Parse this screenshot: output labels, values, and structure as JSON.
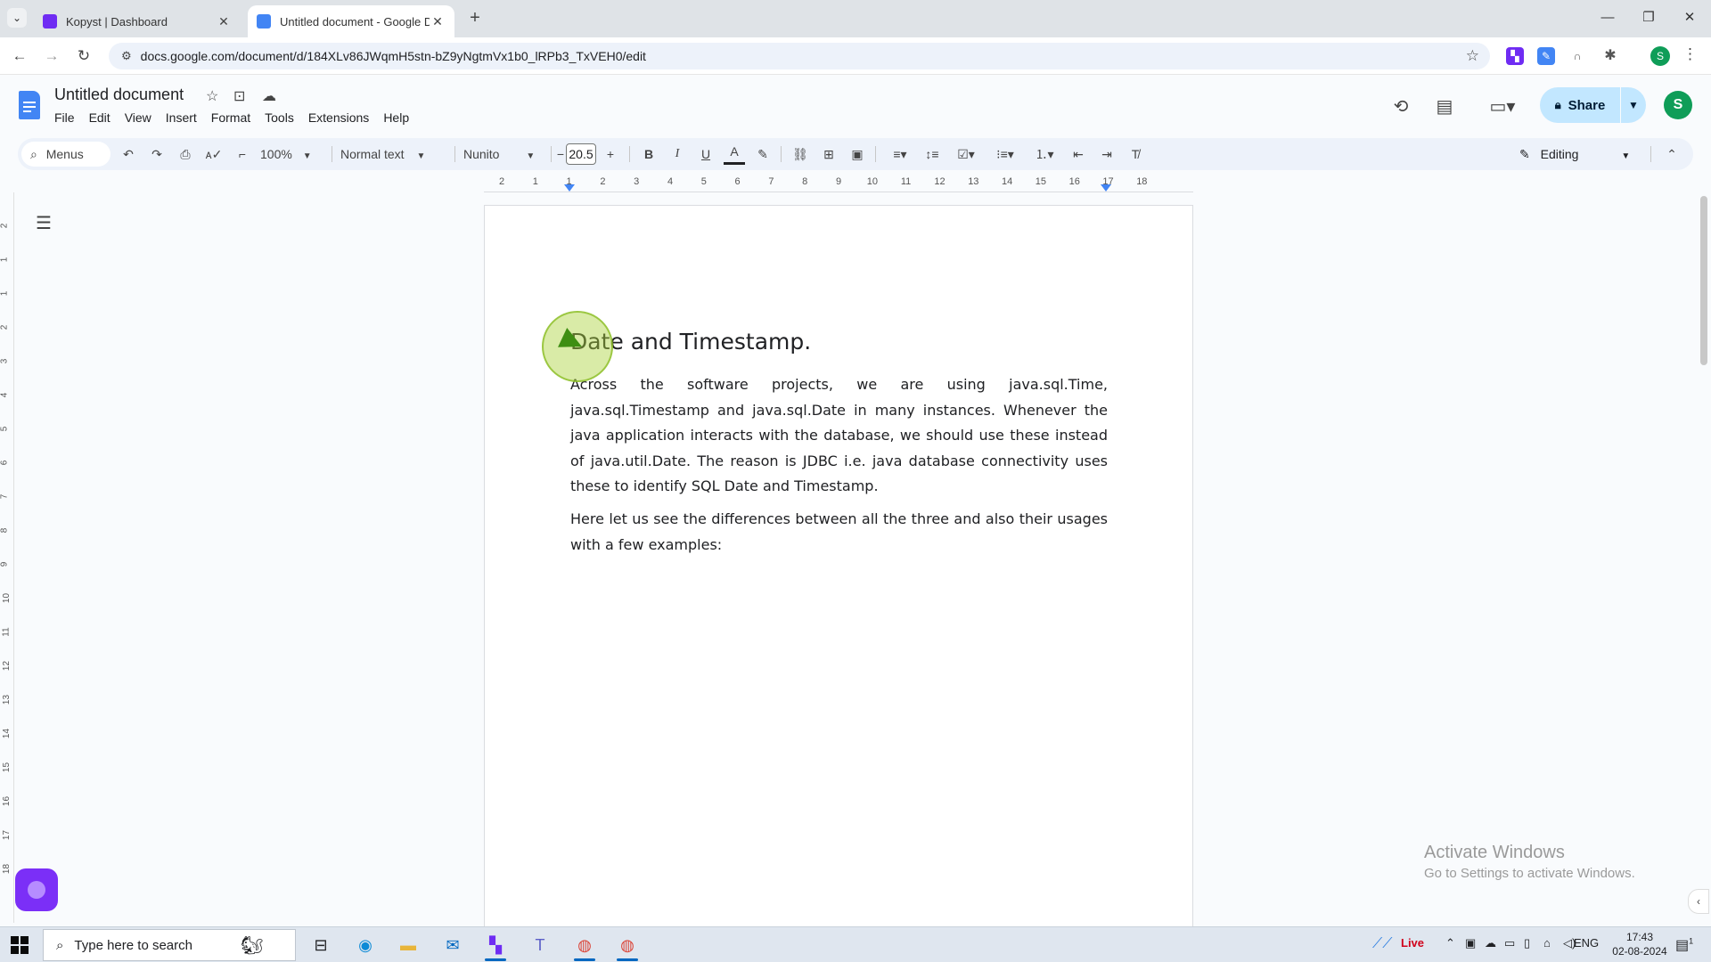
{
  "browser": {
    "tabs": [
      {
        "label": "Kopyst | Dashboard",
        "active": false,
        "favicon_color": "#6f2cf3"
      },
      {
        "label": "Untitled document - Google Do",
        "active": true,
        "favicon_color": "#4285f4"
      }
    ],
    "tab_menu_glyph": "⌄",
    "new_tab_glyph": "+",
    "window_controls": {
      "minimize": "—",
      "restore": "❐",
      "close": "✕"
    },
    "url": "docs.google.com/document/d/184XLv86JWqmH5stn-bZ9yNgtmVx1b0_lRPb3_TxVEH0/edit",
    "profile_initial": "S"
  },
  "docs": {
    "title": "Untitled document",
    "menu": [
      "File",
      "Edit",
      "View",
      "Insert",
      "Format",
      "Tools",
      "Extensions",
      "Help"
    ],
    "share_label": "Share",
    "account_initial": "S",
    "toolbar": {
      "menus_label": "Menus",
      "zoom": "100%",
      "style": "Normal text",
      "font": "Nunito",
      "font_size": "20.5",
      "mode": "Editing"
    },
    "ruler_ticks": [
      "2",
      "1",
      "1",
      "2",
      "3",
      "4",
      "5",
      "6",
      "7",
      "8",
      "9",
      "10",
      "11",
      "12",
      "13",
      "14",
      "15",
      "16",
      "17",
      "18"
    ],
    "vertical_ruler_ticks": [
      "2",
      "1",
      "1",
      "2",
      "3",
      "4",
      "5",
      "6",
      "7",
      "8",
      "9",
      "10",
      "11",
      "12",
      "13",
      "14",
      "15",
      "16",
      "17",
      "18"
    ],
    "content": {
      "heading": "Date and Timestamp.",
      "paragraphs": [
        "Across the software projects, we are using java.sql.Time, java.sql.Timestamp and java.sql.Date in many instances. Whenever the java application interacts with the database, we should use these instead of java.util.Date. The reason is JDBC i.e. java database connectivity uses these to identify SQL Date and Timestamp.",
        "Here let us see the differences between all the three and also their usages with a few examples:"
      ]
    }
  },
  "watermark": {
    "title": "Activate Windows",
    "subtitle": "Go to Settings to activate Windows."
  },
  "taskbar": {
    "search_placeholder": "Type here to search",
    "weather": "Live",
    "language": "ENG",
    "time": "17:43",
    "date": "02-08-2024",
    "notification_count": "1"
  },
  "colors": {
    "accent": "#4285f4",
    "share_bg": "#c2e7ff",
    "avatar": "#0f9d58",
    "widget": "#7b2ff7",
    "click_ring": "#aad23c"
  }
}
